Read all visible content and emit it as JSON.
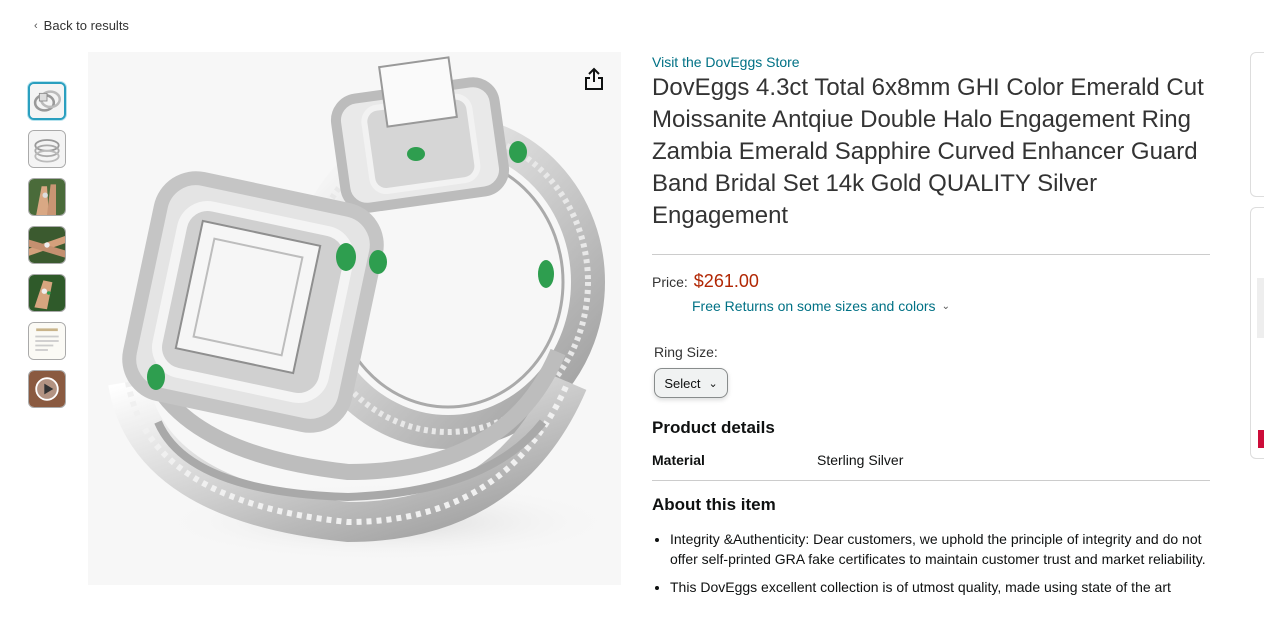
{
  "nav": {
    "back_label": "Back to results"
  },
  "gallery": {
    "thumbnails": [
      "ring-image",
      "ring-set-image",
      "hand-image",
      "hands-image",
      "hand-image",
      "certificate-image",
      "video-thumbnail"
    ],
    "active_index": 0
  },
  "product": {
    "store_link": "Visit the DovEggs Store",
    "title": "DovEggs 4.3ct Total 6x8mm GHI Color Emerald Cut Moissanite Antqiue Double Halo Engagement Ring Zambia Emerald Sapphire Curved Enhancer Guard Band Bridal Set 14k Gold QUALITY Silver Engagement",
    "price_label": "Price:",
    "price": "$261.00",
    "returns_text": "Free Returns on some sizes and colors",
    "ring_size_label": "Ring Size:",
    "ring_size_select": "Select"
  },
  "details": {
    "heading": "Product details",
    "rows": [
      {
        "key": "Material",
        "value": "Sterling Silver"
      }
    ]
  },
  "about": {
    "heading": "About this item",
    "bullets": [
      "Integrity &Authenticity: Dear customers, we uphold the principle of integrity and do not offer self-printed GRA fake certificates to maintain customer trust and market reliability.",
      "This DovEggs excellent collection is of utmost quality, made using state of the art"
    ]
  },
  "colors": {
    "link": "#007185",
    "price": "#b12704",
    "accent": "#2a9fbf",
    "emerald": "#2e9e4f"
  }
}
